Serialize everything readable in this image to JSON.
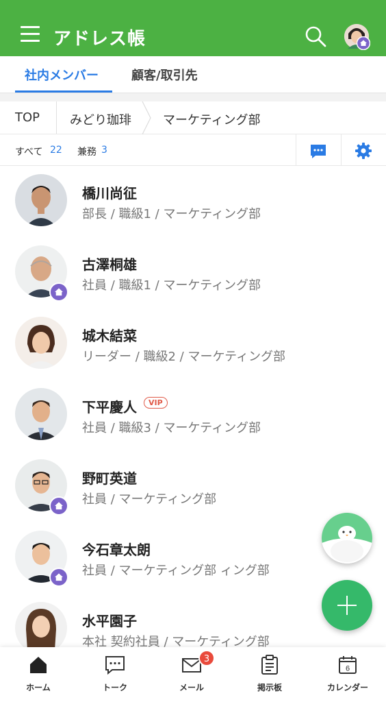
{
  "header": {
    "title": "アドレス帳"
  },
  "tabs": [
    {
      "label": "社内メンバー",
      "active": true
    },
    {
      "label": "顧客/取引先",
      "active": false
    }
  ],
  "breadcrumb": [
    "TOP",
    "みどり珈琲",
    "マーケティング部"
  ],
  "counts": {
    "all_label": "すべて",
    "all_value": "22",
    "concurrent_label": "兼務",
    "concurrent_value": "3"
  },
  "members": [
    {
      "name": "橋川尚征",
      "detail": "部長 / 職級1 / マーケティング部",
      "home_badge": false,
      "vip": ""
    },
    {
      "name": "古澤桐雄",
      "detail": "社員 / 職級1 / マーケティング部",
      "home_badge": true,
      "vip": ""
    },
    {
      "name": "城木結菜",
      "detail": "リーダー / 職級2 / マーケティング部",
      "home_badge": false,
      "vip": ""
    },
    {
      "name": "下平慶人",
      "detail": "社員 / 職級3 / マーケティング部",
      "home_badge": false,
      "vip": "VIP"
    },
    {
      "name": "野町英道",
      "detail": "社員 / マーケティング部",
      "home_badge": true,
      "vip": ""
    },
    {
      "name": "今石章太朗",
      "detail": "社員 / マーケティング部 ィング部",
      "home_badge": true,
      "vip": ""
    },
    {
      "name": "水平園子",
      "detail": "本社 契約社員 / マーケティング部",
      "home_badge": false,
      "vip": ""
    }
  ],
  "bottom_nav": [
    {
      "label": "ホーム",
      "icon": "home-icon"
    },
    {
      "label": "トーク",
      "icon": "talk-icon"
    },
    {
      "label": "メール",
      "icon": "mail-icon",
      "badge": "3"
    },
    {
      "label": "掲示板",
      "icon": "board-icon"
    },
    {
      "label": "カレンダー",
      "icon": "calendar-icon",
      "calendar_day": "6"
    }
  ],
  "colors": {
    "header": "#4cb143",
    "accent": "#2a7be4",
    "badge": "#7b63c9",
    "fab": "#35b96a"
  }
}
